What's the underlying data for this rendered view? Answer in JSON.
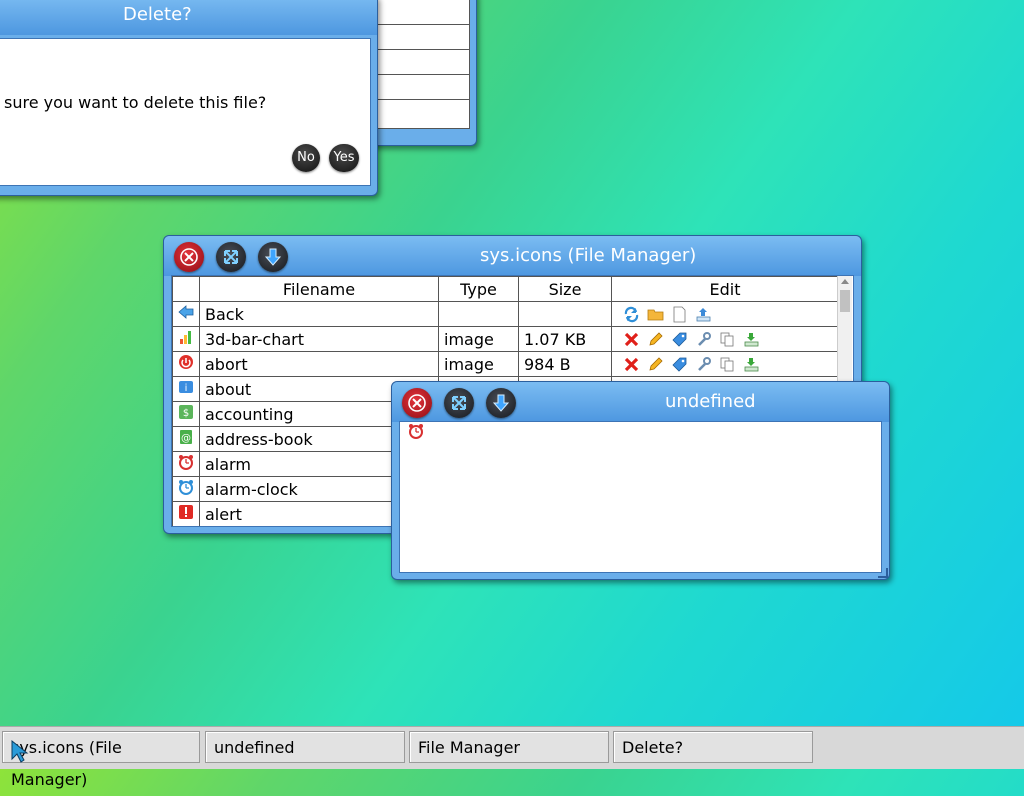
{
  "delete_dialog": {
    "title": "Delete?",
    "message": "sure you want to delete this file?",
    "no_label": "No",
    "yes_label": "Yes"
  },
  "file_manager": {
    "title": "sys.icons (File Manager)",
    "columns": [
      "Filename",
      "Type",
      "Size",
      "Edit"
    ],
    "rows": [
      {
        "name": "Back",
        "type": "",
        "size": "",
        "icon": "back-arrow-icon"
      },
      {
        "name": "3d-bar-chart",
        "type": "image",
        "size": "1.07 KB",
        "icon": "bar-chart-icon"
      },
      {
        "name": "abort",
        "type": "image",
        "size": "984 B",
        "icon": "abort-icon"
      },
      {
        "name": "about",
        "type": "",
        "size": "",
        "icon": "about-icon"
      },
      {
        "name": "accounting",
        "type": "",
        "size": "",
        "icon": "accounting-icon"
      },
      {
        "name": "address-book",
        "type": "",
        "size": "",
        "icon": "address-book-icon"
      },
      {
        "name": "alarm",
        "type": "",
        "size": "",
        "icon": "alarm-icon"
      },
      {
        "name": "alarm-clock",
        "type": "",
        "size": "",
        "icon": "alarm-clock-icon"
      },
      {
        "name": "alert",
        "type": "",
        "size": "",
        "icon": "alert-icon"
      }
    ]
  },
  "viewer": {
    "title": "undefined",
    "image_icon": "alarm-icon"
  },
  "taskbar": {
    "tasks": [
      "sys.icons (File Manager)",
      "undefined",
      "File Manager",
      "Delete?"
    ]
  },
  "colors": {
    "titlebar": "#5aa3e6",
    "close_button": "#c81f28",
    "dark_button": "#2a2e35"
  }
}
